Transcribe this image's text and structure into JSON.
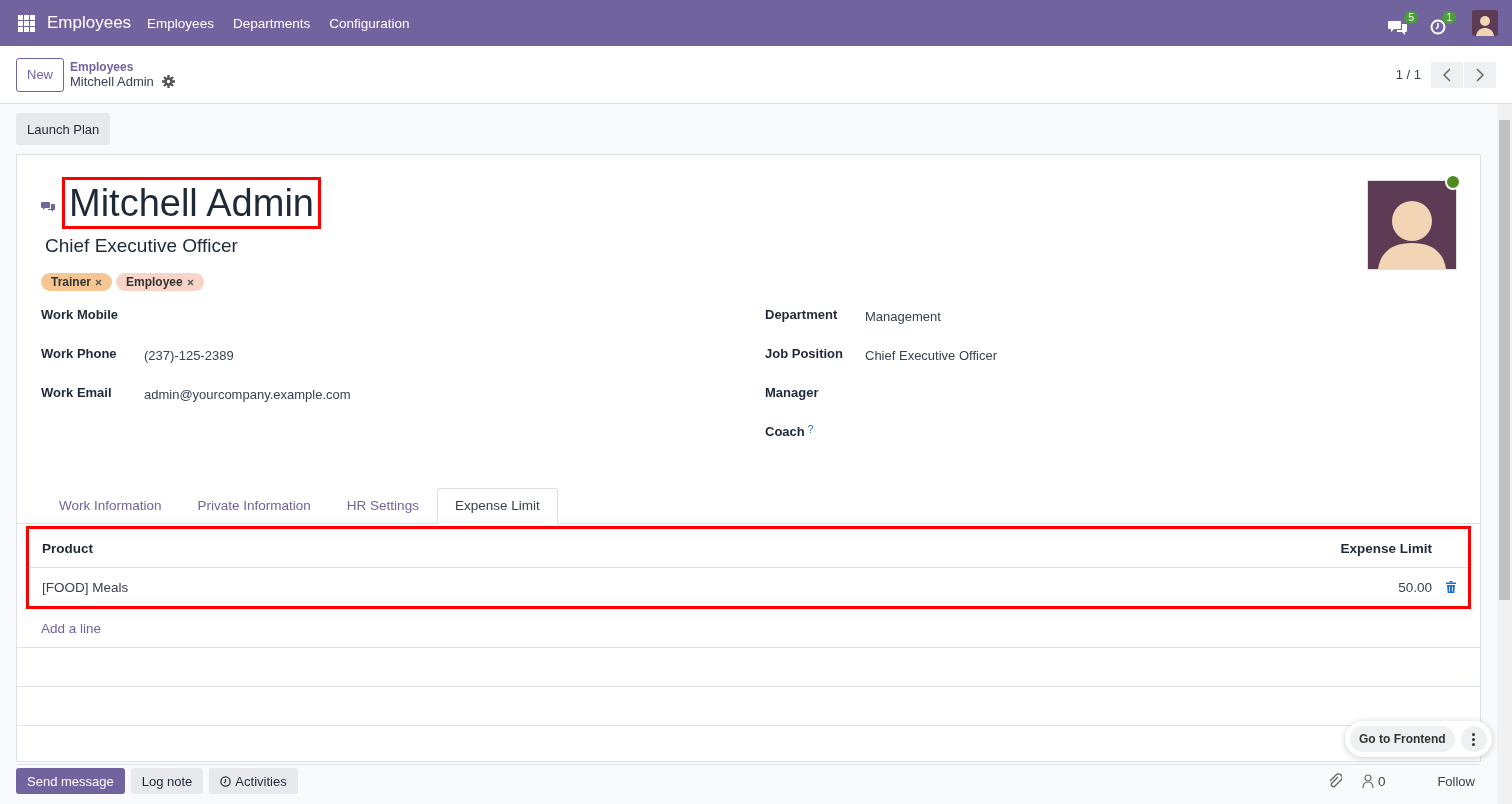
{
  "navbar": {
    "app_name": "Employees",
    "menu": [
      "Employees",
      "Departments",
      "Configuration"
    ],
    "messages_badge": "5",
    "activities_badge": "1"
  },
  "control_panel": {
    "new_button": "New",
    "breadcrumb_parent": "Employees",
    "breadcrumb_current": "Mitchell Admin",
    "pager": "1 / 1"
  },
  "action_buttons": [
    "Launch Plan"
  ],
  "employee": {
    "name": "Mitchell Admin",
    "name_highlighted": true,
    "job_title": "Chief Executive Officer",
    "online": true,
    "tags": [
      {
        "label": "Trainer",
        "color": "#f5c592"
      },
      {
        "label": "Employee",
        "color": "#f7d4c7"
      }
    ]
  },
  "fields_left": [
    {
      "label": "Work Mobile"
    },
    {
      "label": "Work Phone",
      "value": "(237)-125-2389"
    },
    {
      "label": "Work Email",
      "value": "admin@yourcompany.example.com"
    }
  ],
  "fields_right": [
    {
      "label": "Department",
      "value": "Management"
    },
    {
      "label": "Job Position",
      "value": "Chief Executive Officer"
    },
    {
      "label": "Manager"
    },
    {
      "label": "Coach",
      "help": "?"
    }
  ],
  "tabs": [
    {
      "label": "Work Information",
      "selected": false
    },
    {
      "label": "Private Information",
      "selected": false
    },
    {
      "label": "HR Settings",
      "selected": false
    },
    {
      "label": "Expense Limit",
      "selected": true
    }
  ],
  "expense_table": {
    "highlighted": true,
    "columns": [
      "Product",
      "Expense Limit"
    ],
    "rows": [
      {
        "product": "[FOOD] Meals",
        "limit": "50.00"
      }
    ],
    "add_line": "Add a line"
  },
  "floating": {
    "go_to_frontend": "Go to Frontend"
  },
  "chatter": {
    "buttons": [
      {
        "label": "Send message",
        "kind": "primary"
      },
      {
        "label": "Log note",
        "kind": "secondary"
      },
      {
        "label": "Activities",
        "kind": "activities"
      }
    ],
    "followers": "0",
    "follow": "Follow"
  }
}
